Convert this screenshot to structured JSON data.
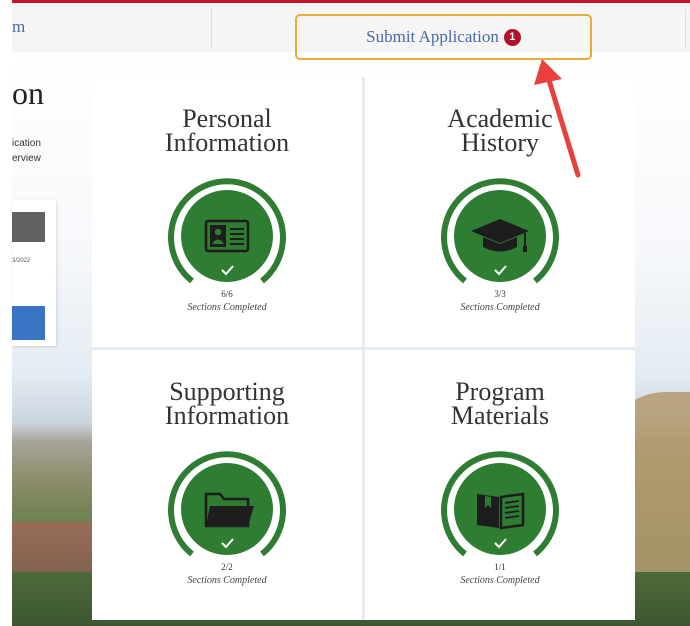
{
  "nav": {
    "prev_fragment": "m",
    "submit_label": "Submit Application",
    "submit_badge": "1"
  },
  "left_panel": {
    "title_fragment": "on",
    "desc_line1": "ication",
    "desc_line2": "erview",
    "date_fragment": "3/2022"
  },
  "tiles": [
    {
      "title_line1": "Personal",
      "title_line2": "Information",
      "icon": "id-card-icon",
      "count": "6/6",
      "caption": "Sections Completed"
    },
    {
      "title_line1": "Academic",
      "title_line2": "History",
      "icon": "graduation-cap-icon",
      "count": "3/3",
      "caption": "Sections Completed"
    },
    {
      "title_line1": "Supporting",
      "title_line2": "Information",
      "icon": "folder-icon",
      "count": "2/2",
      "caption": "Sections Completed"
    },
    {
      "title_line1": "Program",
      "title_line2": "Materials",
      "icon": "book-icon",
      "count": "1/1",
      "caption": "Sections Completed"
    }
  ],
  "colors": {
    "accent_red": "#c8102e",
    "highlight_orange": "#e8ac3a",
    "link_blue": "#4a6aa5",
    "badge_red": "#b0122c",
    "complete_green": "#2e7d32",
    "arrow_red": "#e8413c"
  }
}
